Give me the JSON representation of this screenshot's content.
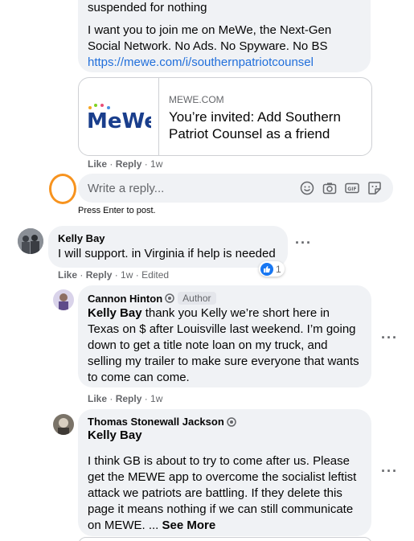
{
  "comment_1": {
    "text_lines": [
      "suspended for nothing",
      "I want you to join me on MeWe, the Next-Gen",
      "Social Network. No Ads. No Spyware. No BS"
    ],
    "link": "https://mewe.com/i/southernpatriotcounsel",
    "preview": {
      "logo_text": "MeWe",
      "domain": "MEWE.COM",
      "title": "You’re invited: Add Southern Patriot Counsel as a friend"
    },
    "actions": {
      "like": "Like",
      "reply": "Reply",
      "time": "1w"
    }
  },
  "reply_box": {
    "placeholder": "Write a reply...",
    "hint": "Press Enter to post.",
    "icons": [
      "emoji-icon",
      "camera-icon",
      "gif-icon",
      "sticker-icon"
    ]
  },
  "comment_2": {
    "author": "Kelly Bay",
    "text": "I will support. in Virginia if help is needed",
    "reaction_count": "1",
    "actions": {
      "like": "Like",
      "reply": "Reply",
      "time": "1w",
      "edited": "Edited"
    }
  },
  "comment_3": {
    "author": "Cannon Hinton",
    "badge": "Author",
    "mention": "Kelly Bay",
    "text": "thank you Kelly we’re short here in Texas on $ after Louisville last weekend. I’m going down to get a title note loan on my truck, and selling my trailer to make sure everyone that wants to come can come.",
    "actions": {
      "like": "Like",
      "reply": "Reply",
      "time": "1w"
    }
  },
  "comment_4": {
    "author": "Thomas Stonewall Jackson",
    "mention": "Kelly Bay",
    "text": "I think GB is about to try to come after us. Please get the MEWE app to overcome the socialist leftist attack we patriots are battling. If they delete this page it means nothing if we can still communicate on MEWE. ...",
    "see_more": "See More"
  },
  "colors": {
    "bubble": "#f0f2f5",
    "link": "#216fdb",
    "muted": "#65676b",
    "accent_ring": "#f7931e",
    "like_blue": "#1877f2"
  }
}
